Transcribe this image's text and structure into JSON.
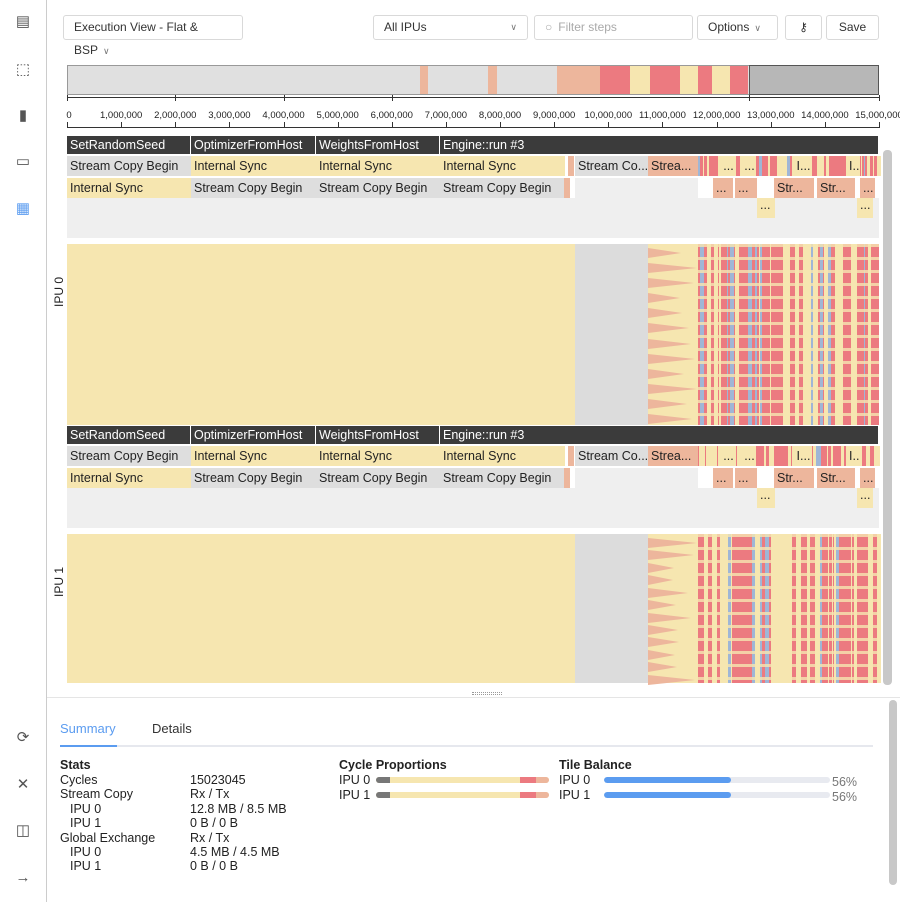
{
  "toolbar": {
    "view_select": "Execution View - Flat & BSP",
    "ipu_select": "All IPUs",
    "filter_placeholder": "Filter steps",
    "options_label": "Options",
    "key_icon": "⚷",
    "save_label": "Save"
  },
  "sidebar": {
    "icons": [
      "report-icon",
      "chip-icon",
      "bar-chart-icon",
      "document-icon",
      "table-grid-icon"
    ],
    "bottom_icons": [
      "refresh-icon",
      "close-icon",
      "book-icon",
      "arrow-right-icon"
    ]
  },
  "ruler": {
    "ticks": [
      "0",
      "1,000,000",
      "2,000,000",
      "3,000,000",
      "4,000,000",
      "5,000,000",
      "6,000,000",
      "7,000,000",
      "8,000,000",
      "9,000,000",
      "10,000,000",
      "11,000,000",
      "12,000,000",
      "13,000,000",
      "14,000,000",
      "15,000,000"
    ]
  },
  "ipus": [
    {
      "label": "IPU 0",
      "header": [
        "SetRandomSeed",
        "OptimizerFromHost",
        "WeightsFromHost",
        "Engine::run #3"
      ],
      "row1": [
        "Stream Copy Begin",
        "Internal Sync",
        "Internal Sync",
        "Internal Sync",
        "Stream Co...",
        "Strea..."
      ],
      "row2": [
        "Internal Sync",
        "Stream Copy Begin",
        "Stream Copy Begin",
        "Stream Copy Begin"
      ],
      "row1_short": [
        "...",
        "...",
        "I...",
        "I..."
      ],
      "row2_short": [
        "...",
        "...",
        "Str...",
        "Str...",
        "..."
      ],
      "row3_short": [
        "...",
        "..."
      ]
    },
    {
      "label": "IPU 1",
      "header": [
        "SetRandomSeed",
        "OptimizerFromHost",
        "WeightsFromHost",
        "Engine::run #3"
      ],
      "row1": [
        "Stream Copy Begin",
        "Internal Sync",
        "Internal Sync",
        "Internal Sync",
        "Stream Co...",
        "Strea..."
      ],
      "row2": [
        "Internal Sync",
        "Stream Copy Begin",
        "Stream Copy Begin",
        "Stream Copy Begin"
      ],
      "row1_short": [
        "...",
        "...",
        "I...",
        "I..."
      ],
      "row2_short": [
        "...",
        "...",
        "Str...",
        "Str...",
        "..."
      ],
      "row3_short": [
        "...",
        "..."
      ]
    }
  ],
  "tabs": {
    "summary": "Summary",
    "details": "Details",
    "active": "Summary"
  },
  "stats": {
    "title": "Stats",
    "rows": [
      {
        "label": "Cycles",
        "value": "15023045",
        "indent": false
      },
      {
        "label": "Stream Copy",
        "value": "Rx / Tx",
        "indent": false
      },
      {
        "label": "IPU 0",
        "value": "12.8 MB / 8.5 MB",
        "indent": true
      },
      {
        "label": "IPU 1",
        "value": "0 B / 0 B",
        "indent": true
      },
      {
        "label": "Global Exchange",
        "value": "Rx / Tx",
        "indent": false
      },
      {
        "label": "IPU 0",
        "value": "4.5 MB / 4.5 MB",
        "indent": true
      },
      {
        "label": "IPU 1",
        "value": "0 B / 0 B",
        "indent": true
      }
    ]
  },
  "cycle_proportions": {
    "title": "Cycle Proportions",
    "rows": [
      {
        "label": "IPU 0"
      },
      {
        "label": "IPU 1"
      }
    ]
  },
  "tile_balance": {
    "title": "Tile Balance",
    "rows": [
      {
        "label": "IPU 0",
        "value": "56%",
        "fraction": 0.56
      },
      {
        "label": "IPU 1",
        "value": "56%",
        "fraction": 0.56
      }
    ]
  },
  "colors": {
    "accent": "#5b9cf0",
    "sync": "#f6e6b0",
    "stream": "#dedede",
    "exchange": "#edb69c",
    "compute": "#ec7a80"
  }
}
